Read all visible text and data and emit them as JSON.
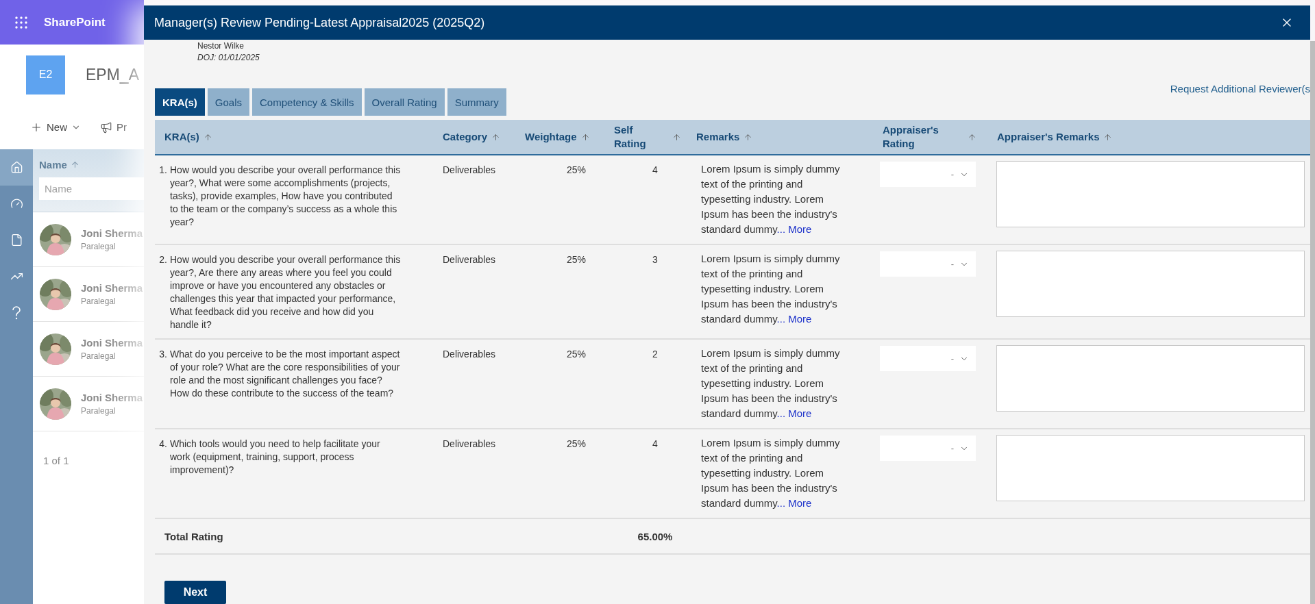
{
  "app": {
    "name": "SharePoint",
    "site_logo": "E2",
    "site_title": "EPM_A",
    "commands": [
      {
        "kind": "new",
        "label": "New"
      },
      {
        "kind": "promote",
        "label": "Pr"
      }
    ]
  },
  "nav_rail": [
    {
      "kind": "home",
      "selected": true
    },
    {
      "kind": "gauge",
      "selected": false
    },
    {
      "kind": "document",
      "selected": false
    },
    {
      "kind": "chart",
      "selected": false
    },
    {
      "kind": "help",
      "selected": false
    }
  ],
  "list": {
    "column": "Name",
    "filter_placeholder": "Name",
    "rows": [
      {
        "name": "Joni Sherma",
        "role": "Paralegal"
      },
      {
        "name": "Joni Sherma",
        "role": "Paralegal"
      },
      {
        "name": "Joni Sherma",
        "role": "Paralegal"
      },
      {
        "name": "Joni Sherma",
        "role": "Paralegal"
      }
    ],
    "pager": "1 of 1"
  },
  "dialog": {
    "title": "Manager(s) Review Pending-Latest Appraisal2025 (2025Q2)",
    "employee": {
      "name": "Nestor Wilke",
      "doj": "DOJ: 01/01/2025"
    },
    "tabs": [
      {
        "label": "KRA(s)",
        "selected": true
      },
      {
        "label": "Goals",
        "selected": false
      },
      {
        "label": "Competency & Skills",
        "selected": false
      },
      {
        "label": "Overall Rating",
        "selected": false
      },
      {
        "label": "Summary",
        "selected": false
      }
    ],
    "link": "Request Additional Reviewer(s",
    "table": {
      "columns": [
        {
          "label": "KRA(s)"
        },
        {
          "label": "Category"
        },
        {
          "label": "Weightage"
        },
        {
          "label": "Self Rating"
        },
        {
          "label": "Remarks"
        },
        {
          "label": "Appraiser's Rating"
        },
        {
          "label": "Appraiser's Remarks"
        }
      ],
      "rows": [
        {
          "number": "1.",
          "question": "How would you describe your overall performance this year?, What were some accomplishments (projects, tasks), provide examples, How have you contributed to the team or the company’s success as a whole this year?",
          "category": "Deliverables",
          "weightage": "25%",
          "self_rating": "4",
          "remarks": "Lorem Ipsum is simply dummy text of the printing and typesetting industry. Lorem Ipsum has been the industry's standard dummy",
          "more": "... More",
          "appraiser_rating": "-"
        },
        {
          "number": "2.",
          "question": "How would you describe your overall performance this year?, Are there any areas where you feel you could improve or have you encountered any obstacles or challenges this year that impacted your performance, What feedback did you receive and how did you handle it?",
          "category": "Deliverables",
          "weightage": "25%",
          "self_rating": "3",
          "remarks": "Lorem Ipsum is simply dummy text of the printing and typesetting industry. Lorem Ipsum has been the industry's standard dummy",
          "more": "... More",
          "appraiser_rating": "-"
        },
        {
          "number": "3.",
          "question": "What do you perceive to be the most important aspect of your role? What are the core responsibilities of your role and the most significant challenges you face? How do these contribute to the success of the team?",
          "category": "Deliverables",
          "weightage": "25%",
          "self_rating": "2",
          "remarks": "Lorem Ipsum is simply dummy text of the printing and typesetting industry. Lorem Ipsum has been the industry's standard dummy",
          "more": "... More",
          "appraiser_rating": "-"
        },
        {
          "number": "4.",
          "question": "Which tools would you need to help facilitate your work (equipment, training, support, process improvement)?",
          "category": "Deliverables",
          "weightage": "25%",
          "self_rating": "4",
          "remarks": "Lorem Ipsum is simply dummy text of the printing and typesetting industry. Lorem Ipsum has been the industry's standard dummy",
          "more": "... More",
          "appraiser_rating": "-"
        }
      ],
      "total": {
        "label": "Total Rating",
        "value": "65.00%"
      }
    },
    "next_button": "Next"
  }
}
